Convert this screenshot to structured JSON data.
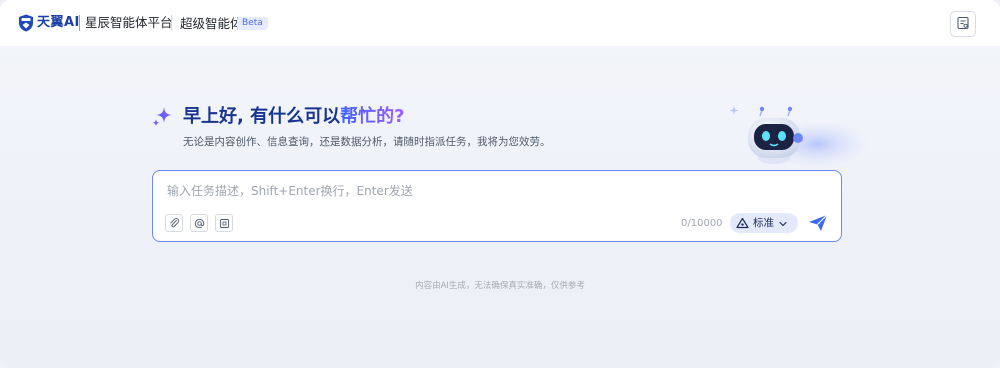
{
  "header": {
    "brand": "天翼AI",
    "platform": "星辰智能体平台",
    "agent_name": "超级智能体",
    "badge": "Beta",
    "colors": {
      "brand": "#1a3fa6",
      "badge_text": "#4a6cf7",
      "badge_bg": "#e6ecff"
    },
    "icons": {
      "logo": "shield-logo-icon",
      "right_button": "notes-icon"
    }
  },
  "hero": {
    "greeting_part1": "早上好, 有什么可以",
    "greeting_part2": "帮忙的?",
    "subtitle": "无论是内容创作、信息查询，还是数据分析，请随时指派任务，我将为您效劳。",
    "icons": {
      "sparkle": "sparkle-icon",
      "mascot": "robot-mascot"
    }
  },
  "composer": {
    "placeholder": "输入任务描述，Shift+Enter换行，Enter发送",
    "value": "",
    "counter": "0/10000",
    "mode_label": "标准",
    "tools": [
      "paperclip-icon",
      "at-icon",
      "image-icon"
    ],
    "accent": "#3d6bf0"
  },
  "footer": {
    "disclaimer": "内容由AI生成，无法确保真实准确，仅供参考"
  }
}
